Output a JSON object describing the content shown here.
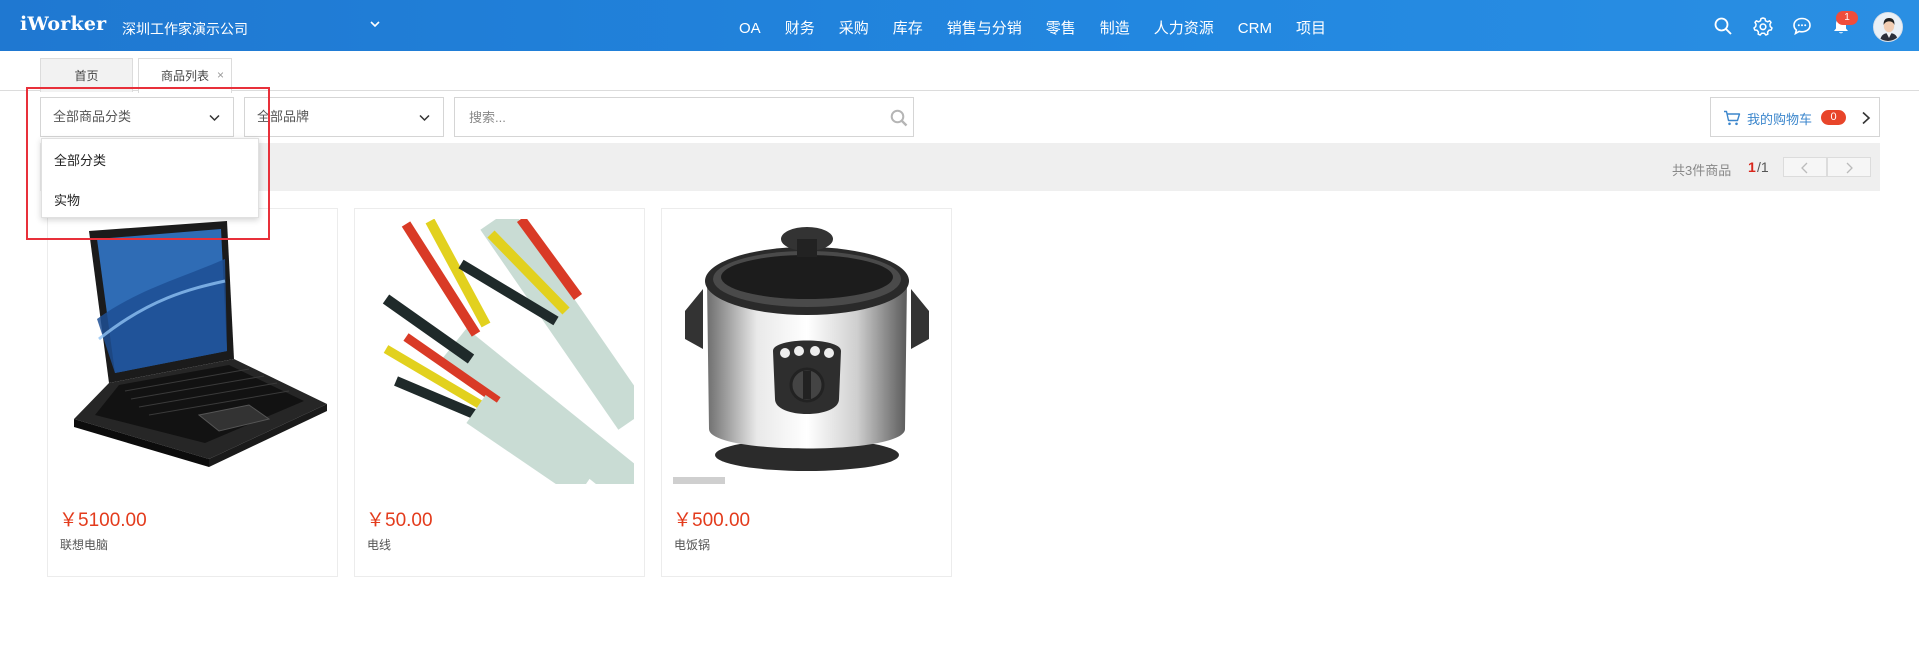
{
  "header": {
    "logo": "iWorker",
    "company": "深圳工作家演示公司",
    "nav": [
      "OA",
      "财务",
      "采购",
      "库存",
      "销售与分销",
      "零售",
      "制造",
      "人力资源",
      "CRM",
      "项目"
    ],
    "notification_count": "1",
    "icons": [
      "search-icon",
      "gear-icon",
      "chat-icon",
      "bell-icon",
      "avatar"
    ],
    "brand_color": "#2287e0"
  },
  "tabs": {
    "home": "首页",
    "goods_list": "商品列表",
    "close": "×"
  },
  "filters": {
    "category_selected": "全部商品分类",
    "brand_selected": "全部品牌",
    "search_placeholder": "搜索..."
  },
  "category_dropdown": {
    "options": [
      "全部分类",
      "实物"
    ]
  },
  "cart": {
    "label": "我的购物车",
    "count": "0"
  },
  "results": {
    "total": "共3件商品",
    "page_current": "1",
    "page_total": "/1"
  },
  "products": [
    {
      "price": "￥5100.00",
      "name": "联想电脑",
      "image": "laptop"
    },
    {
      "price": "￥50.00",
      "name": "电线",
      "image": "wires"
    },
    {
      "price": "￥500.00",
      "name": "电饭锅",
      "image": "rice-cooker"
    }
  ],
  "colors": {
    "price": "#e33b1c",
    "highlight_box": "#e8303a",
    "cart_badge": "#e8452a"
  }
}
